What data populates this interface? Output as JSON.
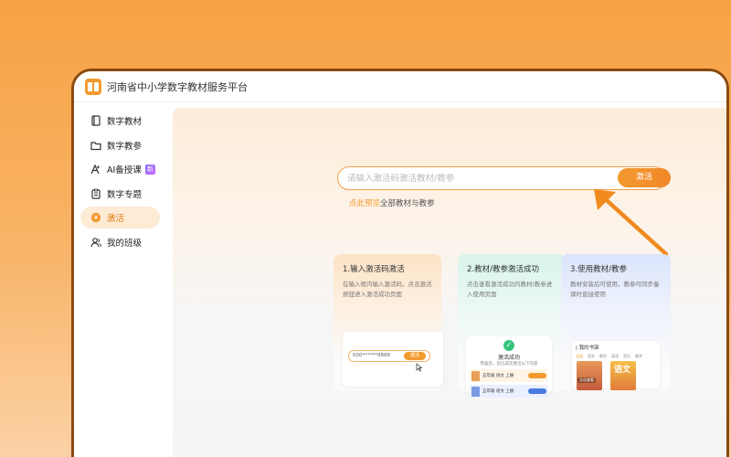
{
  "app": {
    "title": "河南省中小学数字教材服务平台"
  },
  "sidebar": {
    "items": [
      {
        "label": "数字教材",
        "icon": "book-icon"
      },
      {
        "label": "数字教参",
        "icon": "folder-icon"
      },
      {
        "label": "AI备授课",
        "icon": "ai-icon",
        "badge": "新"
      },
      {
        "label": "数字专题",
        "icon": "clipboard-icon"
      },
      {
        "label": "激活",
        "icon": "coin-icon",
        "active": true
      },
      {
        "label": "我的班级",
        "icon": "users-icon"
      }
    ]
  },
  "search": {
    "placeholder": "请输入激活码激活教材/教参",
    "button": "激活"
  },
  "preview": {
    "link": "点此预览",
    "text": "全部教材与教参"
  },
  "steps": [
    {
      "title": "1.输入激活码激活",
      "desc": "在输入框内输入激活码，点击激活按钮进入激活成功页面"
    },
    {
      "title": "2.教材/教参激活成功",
      "desc": "点击查看激活成功的教材/教参进入使用页面"
    },
    {
      "title": "3.使用教材/教参",
      "desc": "教材安装后可使用，教参可同步备课时直接使用"
    }
  ],
  "mock1": {
    "code": "000******8888",
    "btn": "激活"
  },
  "mock2": {
    "title": "激活成功",
    "sub": "恭喜您，您已成功激活以下内容",
    "book1": "五年级 语文 上册",
    "book2": "五年级 语文 上册"
  },
  "mock3": {
    "title": "| 我的书架",
    "tabs": [
      "全部",
      "语文",
      "数学",
      "英语",
      "音乐",
      "美术"
    ],
    "cover_label": "点击查看",
    "cover2_title": "语文"
  },
  "colors": {
    "accent": "#f39a2e",
    "accent_bg": "#fdebd5",
    "success": "#33c47a"
  }
}
